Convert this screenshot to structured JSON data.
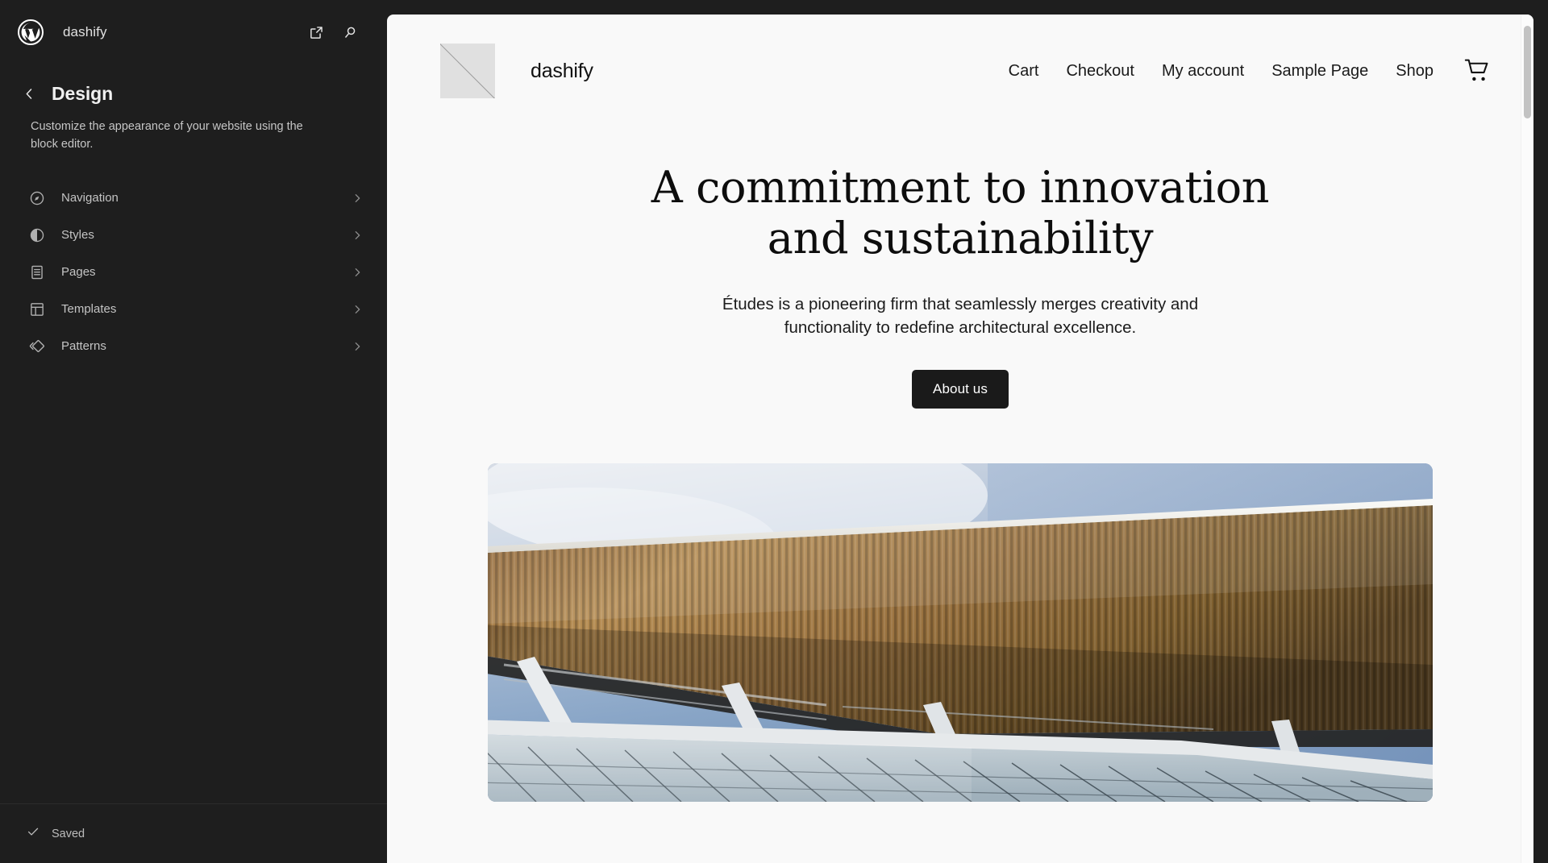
{
  "sidebar": {
    "site_name": "dashify",
    "logo_icon": "wordpress-logo-icon",
    "view_site_icon": "external-link-icon",
    "search_icon": "search-icon",
    "back_icon": "chevron-left-icon",
    "panel_title": "Design",
    "panel_description": "Customize the appearance of your website using the block editor.",
    "items": [
      {
        "label": "Navigation",
        "icon": "compass-icon"
      },
      {
        "label": "Styles",
        "icon": "contrast-half-circle-icon"
      },
      {
        "label": "Pages",
        "icon": "page-document-icon"
      },
      {
        "label": "Templates",
        "icon": "layout-template-icon"
      },
      {
        "label": "Patterns",
        "icon": "patterns-diamond-icon"
      }
    ],
    "chevron_icon": "chevron-right-icon",
    "footer": {
      "save_status": "Saved",
      "save_icon": "check-icon"
    }
  },
  "canvas": {
    "site_header": {
      "logo_alt": "site-logo-placeholder",
      "site_title": "dashify",
      "nav_links": [
        "Cart",
        "Checkout",
        "My account",
        "Sample Page",
        "Shop"
      ],
      "cart_icon": "shopping-cart-icon"
    },
    "hero": {
      "title": "A commitment to innovation and sustainability",
      "subtitle": "Études is a pioneering firm that seamlessly merges creativity and functionality to redefine architectural excellence.",
      "button_label": "About us",
      "image_alt": "architectural-building-photo"
    },
    "scrollbar": {
      "name": "canvas-vertical-scrollbar"
    }
  },
  "colors": {
    "sidebar_bg": "#1e1e1e",
    "canvas_bg": "#f9f9f9",
    "accent_dark": "#1a1a1a",
    "sidebar_text": "#c4c4c4",
    "scrollbar_thumb": "#c2c2c2"
  }
}
